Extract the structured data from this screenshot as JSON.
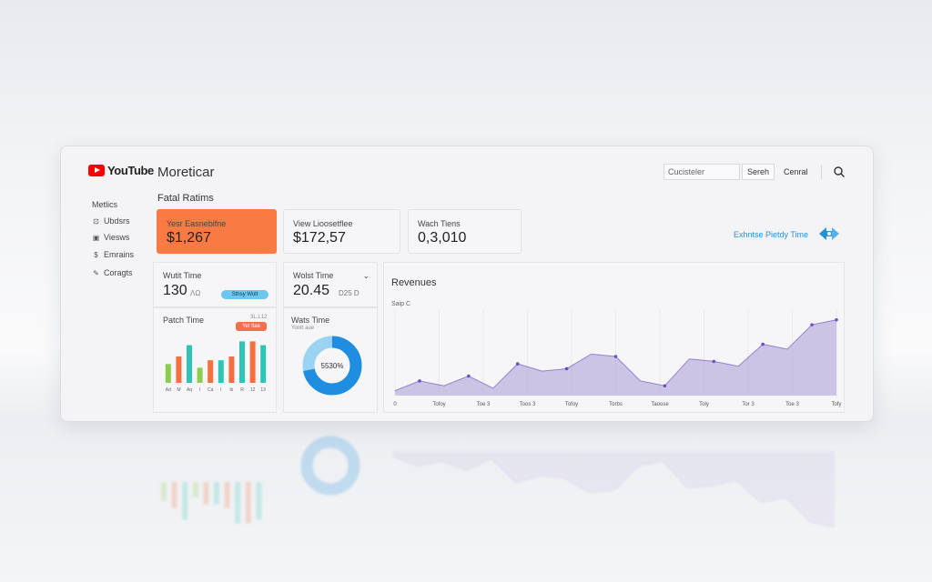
{
  "header": {
    "logo_text": "YouTube",
    "app_title": "Moreticar",
    "search_placeholder": "Cucisteler",
    "search_button": "Sereh",
    "cancel_button": "Cenral"
  },
  "sidebar": {
    "title": "Metlics",
    "items": [
      {
        "icon": "grid-icon",
        "glyph": "⊡",
        "label": "Ubdsrs"
      },
      {
        "icon": "video-icon",
        "glyph": "▣",
        "label": "Viesws"
      },
      {
        "icon": "earnings-icon",
        "glyph": "$",
        "label": "Emrains"
      },
      {
        "icon": "pencil-icon",
        "glyph": "✎",
        "label": "Coragts"
      }
    ]
  },
  "main": {
    "section_title": "Fatal Ratims",
    "cards": [
      {
        "label": "Yesr Easnebifne",
        "value": "$1,267"
      },
      {
        "label": "View Lioosetflee",
        "value": "$172,57"
      },
      {
        "label": "Wach Tiens",
        "value": "0,3,010"
      }
    ],
    "right_link": "Exhntse Pietdy Time",
    "mini_cards": [
      {
        "label": "Wutit Time",
        "value": "130",
        "small": "ΛΩ",
        "pill": "Sthsy Wolt"
      },
      {
        "label": "Wolst Time",
        "value": "20.45",
        "small": "D25 D"
      }
    ],
    "bar_panel": {
      "label": "Patch Time",
      "tag": "Yet ltae",
      "corner": "3L,L12"
    },
    "donut_panel": {
      "label": "Wats Time",
      "sub": "Yontt aue",
      "center": "5530%",
      "percent": 72
    },
    "line_panel": {
      "label": "Revenues",
      "y_label": "Saip C"
    }
  },
  "chart_data": [
    {
      "type": "bar",
      "title": "Patch Time",
      "categories": [
        "Ad",
        "M",
        "Aq",
        "I",
        "Ca",
        "I",
        "bi",
        "R",
        "12",
        "13"
      ],
      "series": [
        {
          "values": [
            5,
            0,
            0,
            4,
            0,
            0,
            0,
            0,
            0,
            0
          ]
        },
        {
          "values": [
            0,
            7,
            0,
            0,
            6,
            0,
            7,
            0,
            11,
            0
          ]
        },
        {
          "values": [
            0,
            0,
            10,
            0,
            0,
            6,
            0,
            11,
            0,
            10
          ]
        }
      ],
      "colors": [
        "#8ccd4e",
        "#f5703e",
        "#2ec4b6"
      ],
      "ylim": [
        0,
        14
      ]
    },
    {
      "type": "pie",
      "title": "Wats Time",
      "values": [
        72,
        28
      ],
      "colors": [
        "#1f8ee0",
        "#9bd3f3"
      ],
      "center_label": "5530%"
    },
    {
      "type": "area",
      "title": "Revenues",
      "ylabel": "Saip C",
      "x_ticks": [
        "0",
        "Tofoy",
        "Toe 3",
        "Toos 3",
        "Tofoy",
        "Torbs",
        "Taoose",
        "Toly",
        "Tor 3",
        "Toe 3",
        "Tofy"
      ],
      "values": [
        2,
        6,
        4,
        8,
        3,
        13,
        10,
        11,
        17,
        16,
        6,
        4,
        15,
        14,
        12,
        21,
        19,
        29,
        31
      ],
      "ylim": [
        0,
        35
      ],
      "color": "#a99ad6",
      "point_color": "#6d4fc2"
    }
  ]
}
